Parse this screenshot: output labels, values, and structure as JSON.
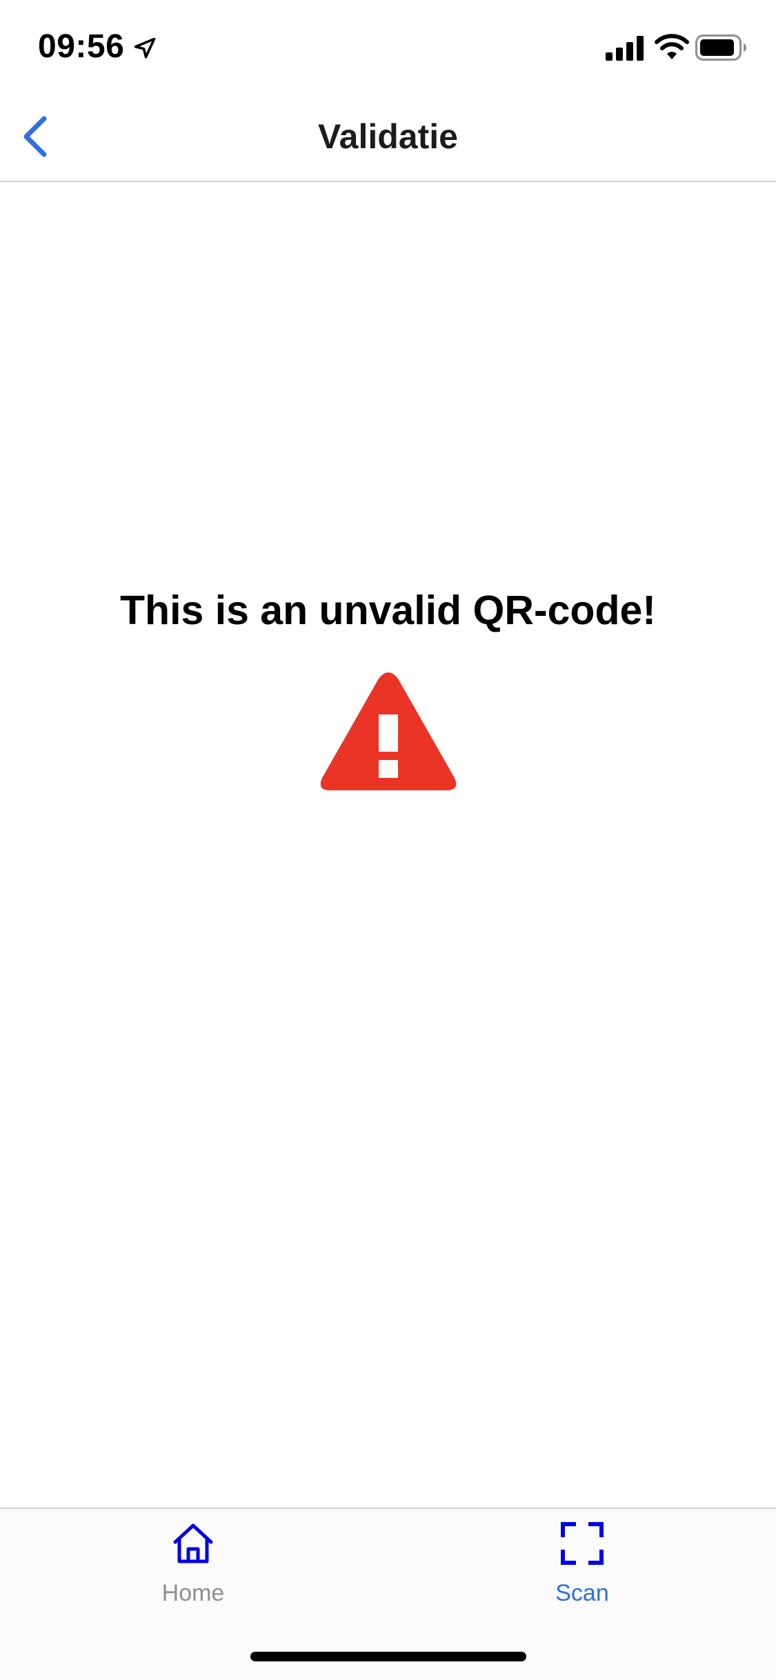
{
  "status_bar": {
    "time": "09:56",
    "icons": [
      "location-arrow-icon",
      "cellular-signal-icon",
      "wifi-icon",
      "battery-icon"
    ]
  },
  "nav_bar": {
    "title": "Validatie",
    "back_icon": "chevron-left-icon"
  },
  "main": {
    "error_message": "This is an unvalid QR-code!",
    "icon": "warning-triangle-icon"
  },
  "tab_bar": {
    "tabs": [
      {
        "label": "Home",
        "icon": "home-icon",
        "selected": false
      },
      {
        "label": "Scan",
        "icon": "scan-frame-icon",
        "selected": true
      }
    ]
  },
  "colors": {
    "accent_blue": "#2f6fe0",
    "tab_icon_blue": "#0000e6",
    "warning_red": "#ea3526",
    "inactive_gray": "#8e8e93"
  }
}
